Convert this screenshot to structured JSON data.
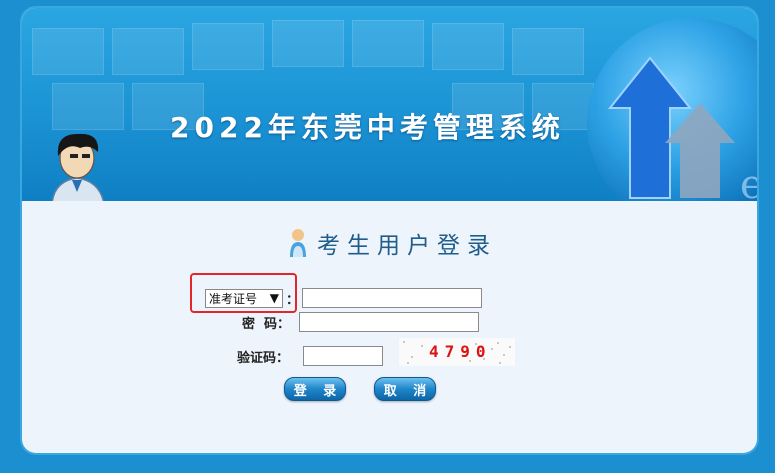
{
  "banner": {
    "title": "2022年东莞中考管理系统"
  },
  "login": {
    "title": "考生用户登录",
    "id_type_selected": "准考证号",
    "id_colon": "：",
    "password_label": "密  码：",
    "captcha_label": "验证码：",
    "captcha_value": "4790",
    "login_button": "登 录",
    "cancel_button": "取 消"
  },
  "colors": {
    "accent": "#1b8fd0",
    "highlight": "#e3262a"
  }
}
